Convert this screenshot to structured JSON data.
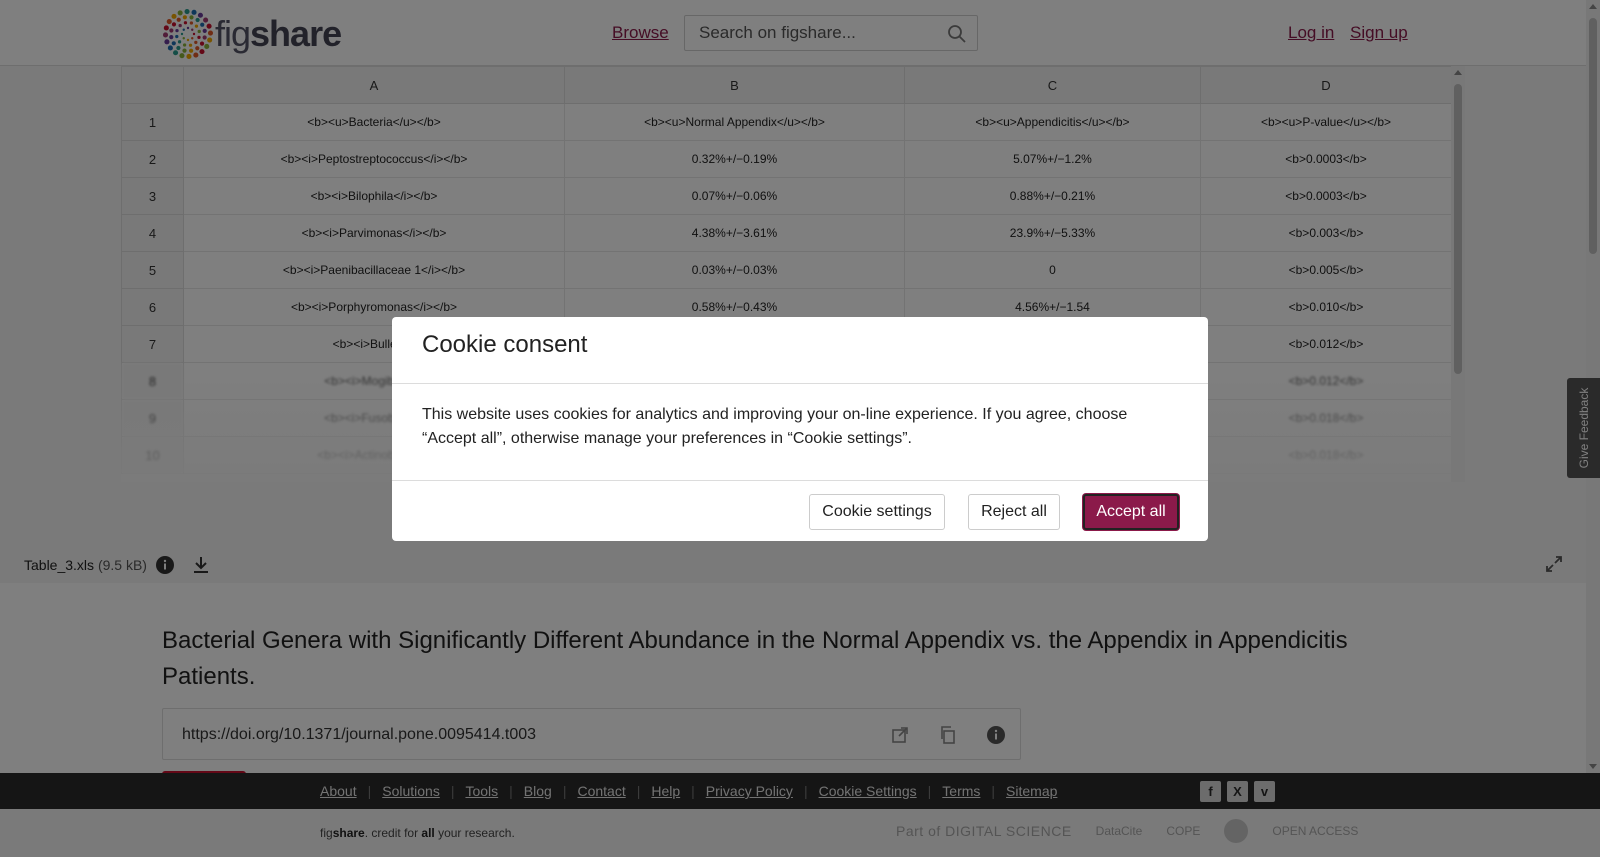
{
  "header": {
    "logo_fig": "fig",
    "logo_share": "share",
    "browse": "Browse",
    "search_placeholder": "Search on figshare...",
    "login": "Log in",
    "signup": "Sign up"
  },
  "sheet": {
    "columns": [
      "A",
      "B",
      "C",
      "D"
    ],
    "rows": [
      {
        "n": "1",
        "a": "<b><u>Bacteria</u></b>",
        "b": "<b><u>Normal Appendix</u></b>",
        "c": "<b><u>Appendicitis</u></b>",
        "d": "<b><u>P-value</u></b>"
      },
      {
        "n": "2",
        "a": "<b><i>Peptostreptococcus</i></b>",
        "b": "0.32%+/−0.19%",
        "c": "5.07%+/−1.2%",
        "d": "<b>0.0003</b>"
      },
      {
        "n": "3",
        "a": "<b><i>Bilophila</i></b>",
        "b": "0.07%+/−0.06%",
        "c": "0.88%+/−0.21%",
        "d": "<b>0.0003</b>"
      },
      {
        "n": "4",
        "a": "<b><i>Parvimonas</i></b>",
        "b": "4.38%+/−3.61%",
        "c": "23.9%+/−5.33%",
        "d": "<b>0.003</b>"
      },
      {
        "n": "5",
        "a": "<b><i>Paenibacillaceae 1</i></b>",
        "b": "0.03%+/−0.03%",
        "c": "0",
        "d": "<b>0.005</b>"
      },
      {
        "n": "6",
        "a": "<b><i>Porphyromonas</i></b>",
        "b": "0.58%+/−0.43%",
        "c": "4.56%+/−1.54",
        "d": "<b>0.010</b>"
      },
      {
        "n": "7",
        "a": "<b><i>Bulleidia",
        "b": "",
        "c": "",
        "d": "<b>0.012</b>"
      },
      {
        "n": "8",
        "a": "<b><i>Mogibacteri",
        "b": "",
        "c": "",
        "d": "<b>0.012</b>"
      },
      {
        "n": "9",
        "a": "<b><i>Fusobacteri",
        "b": "",
        "c": "",
        "d": "<b>0.018</b>"
      },
      {
        "n": "10",
        "a": "<b><i>Actinobacteria",
        "b": "",
        "c": "",
        "d": "<b>0.018</b>"
      }
    ]
  },
  "file": {
    "name": "Table_3.xls",
    "size": "(9.5 kB)"
  },
  "main": {
    "title": "Bacterial Genera with Significantly Different Abundance in the Normal Appendix vs. the Appendix in Appendicitis Patients.",
    "doi": "https://doi.org/10.1371/journal.pone.0095414.t003"
  },
  "footer": {
    "links": [
      "About",
      "Solutions",
      "Tools",
      "Blog",
      "Contact",
      "Help",
      "Privacy Policy",
      "Cookie Settings",
      "Terms",
      "Sitemap"
    ],
    "social": [
      "f",
      "X",
      "v"
    ],
    "tagline_fig": "fig",
    "tagline_share": "share",
    "tagline_mid": ". credit for ",
    "tagline_all": "all",
    "tagline_end": " your research.",
    "partners": [
      "Part of DIGITAL SCIENCE",
      "DataCite",
      "COPE",
      "",
      "OPEN ACCESS"
    ]
  },
  "feedback": "Give Feedback",
  "cookie": {
    "title": "Cookie consent",
    "body": "This website uses cookies for analytics and improving your on-line experience. If you agree, choose “Accept all”, otherwise manage your preferences in “Cookie settings”.",
    "settings": "Cookie settings",
    "reject": "Reject all",
    "accept": "Accept all"
  },
  "colors": {
    "brand": "#8b1a4a",
    "footer_dark": "#2b2b2b"
  }
}
